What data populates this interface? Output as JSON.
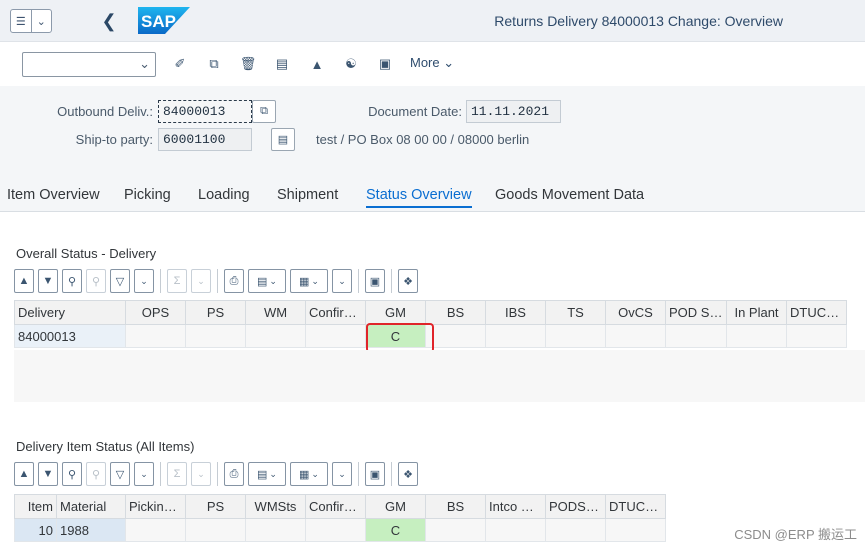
{
  "shell": {
    "title": "Returns Delivery 84000013 Change: Overview",
    "logo_text": "SAP"
  },
  "toolbar": {
    "select_value": "",
    "more_label": "More"
  },
  "header": {
    "outbound_label": "Outbound Deliv.:",
    "outbound_value": "84000013",
    "doc_date_label": "Document Date:",
    "doc_date_value": "11.11.2021",
    "shipto_label": "Ship-to party:",
    "shipto_value": "60001100",
    "shipto_address": "test / PO Box 08 00 00 / 08000 berlin"
  },
  "tabs": [
    {
      "label": "Item Overview"
    },
    {
      "label": "Picking"
    },
    {
      "label": "Loading"
    },
    {
      "label": "Shipment"
    },
    {
      "label": "Status Overview"
    },
    {
      "label": "Goods Movement Data"
    }
  ],
  "overall": {
    "title": "Overall Status - Delivery",
    "columns": [
      "Delivery",
      "OPS",
      "PS",
      "WM",
      "Confirmat.",
      "GM",
      "BS",
      "IBS",
      "TS",
      "OvCS",
      "POD Sta...",
      "In Plant",
      "DTUCSTA"
    ],
    "row": [
      "84000013",
      "",
      "",
      "",
      "",
      "C",
      "",
      "",
      "",
      "",
      "",
      "",
      ""
    ]
  },
  "items": {
    "title": "Delivery Item Status (All Items)",
    "columns": [
      "Item",
      "Material",
      "PickingS...",
      "PS",
      "WMSts",
      "Confirmat.",
      "GM",
      "BS",
      "Intco Bllg",
      "PODStat...",
      "DTUCSTA"
    ],
    "row": [
      "10",
      "1988",
      "",
      "",
      "",
      "",
      "C",
      "",
      "",
      "",
      ""
    ]
  },
  "watermark": "CSDN @ERP 搬运工",
  "colors": {
    "accent": "#0a6ed1",
    "status_green": "#c6efc0",
    "highlight_red": "#e0242a"
  }
}
